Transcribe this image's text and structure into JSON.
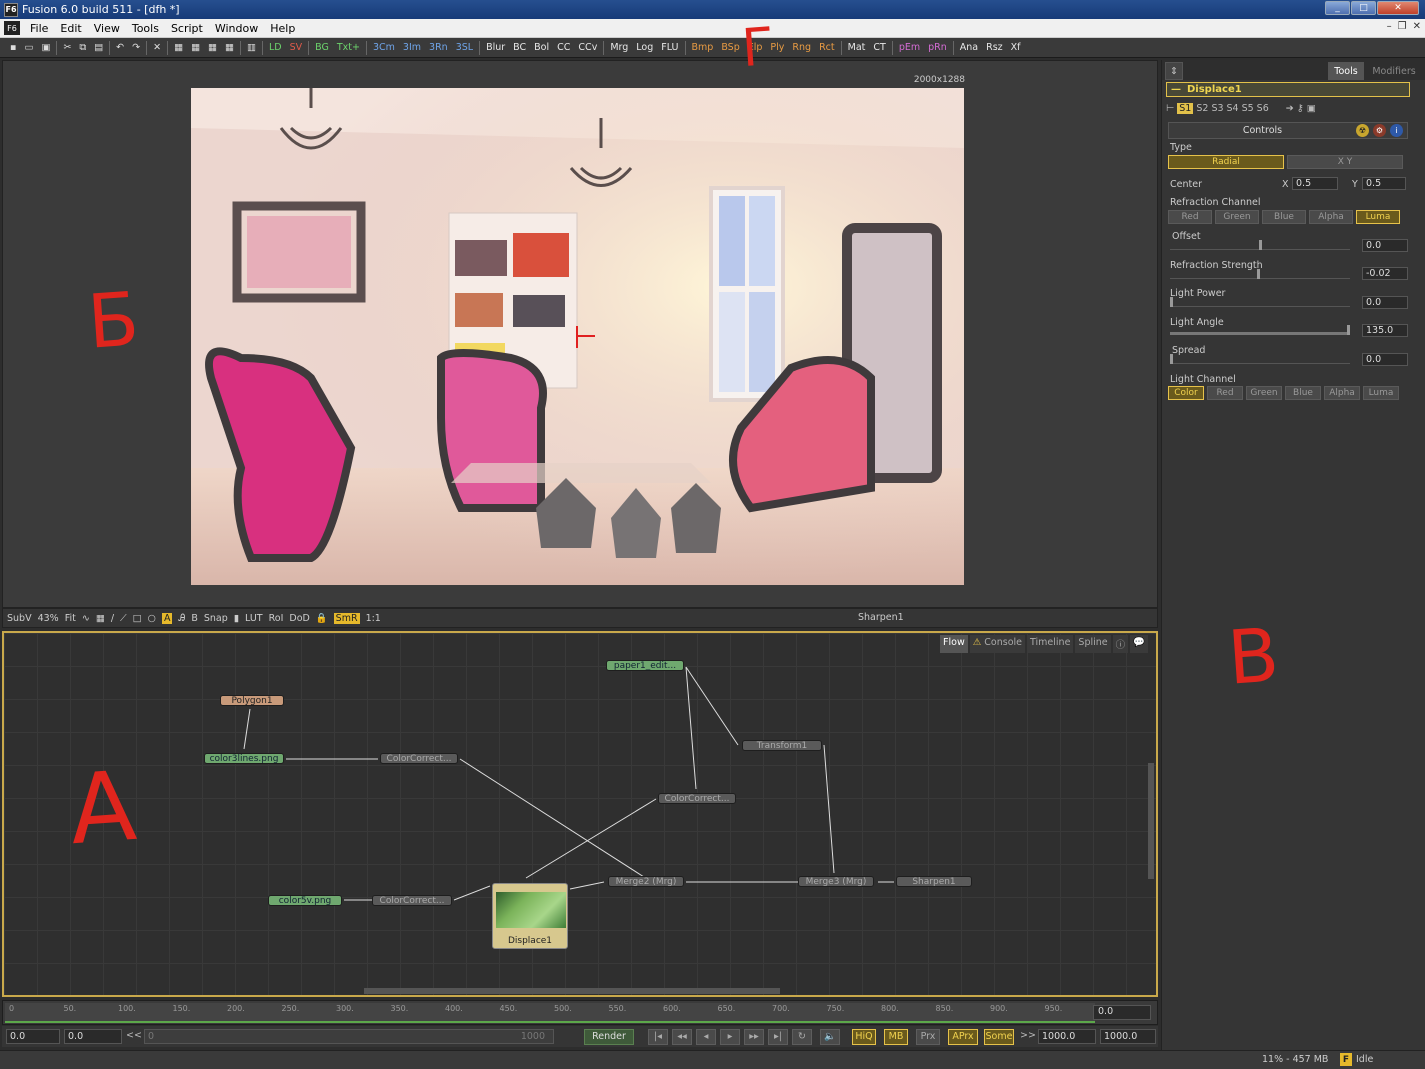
{
  "window": {
    "title": "Fusion 6.0 build 511 - [dfh *]",
    "app_icon": "F6",
    "controls": [
      "_",
      "□",
      "✕"
    ]
  },
  "menu": {
    "icon": "F6",
    "items": [
      "File",
      "Edit",
      "View",
      "Tools",
      "Script",
      "Window",
      "Help"
    ]
  },
  "toolbar": {
    "tools": [
      {
        "label": "LD",
        "color": "green"
      },
      {
        "label": "SV",
        "color": "red"
      },
      {
        "label": "BG",
        "color": "green"
      },
      {
        "label": "Txt+",
        "color": "green"
      },
      {
        "label": "3Cm",
        "color": "blue"
      },
      {
        "label": "3Im",
        "color": "blue"
      },
      {
        "label": "3Rn",
        "color": "blue"
      },
      {
        "label": "3SL",
        "color": "blue"
      },
      {
        "label": "Blur",
        "color": "white"
      },
      {
        "label": "BC",
        "color": "white"
      },
      {
        "label": "Bol",
        "color": "white"
      },
      {
        "label": "CC",
        "color": "white"
      },
      {
        "label": "CCv",
        "color": "white"
      },
      {
        "label": "Mrg",
        "color": "white"
      },
      {
        "label": "Log",
        "color": "white"
      },
      {
        "label": "FLU",
        "color": "white"
      },
      {
        "label": "Bmp",
        "color": "orange"
      },
      {
        "label": "BSp",
        "color": "orange"
      },
      {
        "label": "Elp",
        "color": "orange"
      },
      {
        "label": "Ply",
        "color": "orange"
      },
      {
        "label": "Rng",
        "color": "orange"
      },
      {
        "label": "Rct",
        "color": "orange"
      },
      {
        "label": "Mat",
        "color": "white"
      },
      {
        "label": "CT",
        "color": "white"
      },
      {
        "label": "pEm",
        "color": "magenta"
      },
      {
        "label": "pRn",
        "color": "magenta"
      },
      {
        "label": "Ana",
        "color": "white"
      },
      {
        "label": "Rsz",
        "color": "white"
      },
      {
        "label": "Xf",
        "color": "white"
      }
    ]
  },
  "viewer": {
    "resolution": "2000x1288",
    "name": "Sharpen1",
    "controls": [
      "SubV",
      "43%",
      "Fit",
      "Snap",
      "LUT",
      "RoI",
      "DoD",
      "SmR",
      "1:1"
    ],
    "buttons": [
      "A",
      "B"
    ]
  },
  "panel": {
    "tabs": [
      "Tools",
      "Modifiers"
    ],
    "tool_name": "Displace1",
    "subtabs": [
      "S1",
      "S2",
      "S3",
      "S4",
      "S5",
      "S6"
    ],
    "controls_label": "Controls",
    "type": {
      "label": "Type",
      "options": [
        "Radial",
        "X Y"
      ],
      "selected": "Radial"
    },
    "center": {
      "label": "Center",
      "x_label": "X",
      "x": "0.5",
      "y_label": "Y",
      "y": "0.5"
    },
    "refraction_channel": {
      "label": "Refraction Channel",
      "options": [
        "Red",
        "Green",
        "Blue",
        "Alpha",
        "Luma"
      ],
      "selected": "Luma"
    },
    "offset": {
      "label": "Offset",
      "value": "0.0",
      "level": 0.5
    },
    "refraction_strength": {
      "label": "Refraction Strength",
      "value": "-0.02",
      "level": 0.49
    },
    "light_power": {
      "label": "Light Power",
      "value": "0.0",
      "level": 0.0
    },
    "light_angle": {
      "label": "Light Angle",
      "value": "135.0",
      "level": 1.0
    },
    "spread": {
      "label": "Spread",
      "value": "0.0",
      "level": 0.0
    },
    "light_channel": {
      "label": "Light Channel",
      "options": [
        "Color",
        "Red",
        "Green",
        "Blue",
        "Alpha",
        "Luma"
      ],
      "selected": "Color"
    }
  },
  "flow": {
    "tabs": [
      "Flow",
      "Console",
      "Timeline",
      "Spline"
    ],
    "nodes": {
      "polygon": "Polygon1",
      "color3lines": "color3lines.png",
      "cc1": "ColorCorrect...",
      "paper": "paper1_edit...",
      "transform": "Transform1",
      "cc2": "ColorCorrect...",
      "color5v": "color5v.png",
      "cc3": "ColorCorrect...",
      "displace": "Displace1",
      "merge2": "Merge2  (Mrg)",
      "merge3": "Merge3  (Mrg)",
      "sharpen": "Sharpen1"
    }
  },
  "timeline": {
    "ticks": [
      "0",
      "50.",
      "100.",
      "150.",
      "200.",
      "250.",
      "300.",
      "350.",
      "400.",
      "450.",
      "500.",
      "550.",
      "600.",
      "650.",
      "700.",
      "750.",
      "800.",
      "850.",
      "900.",
      "950."
    ],
    "current": "0.0"
  },
  "transport": {
    "start": "0.0",
    "render_start": "0.0",
    "scroll_left": "<<",
    "scroll_start": "0",
    "scroll_end": "1000",
    "render": "Render",
    "hiq": "HiQ",
    "mb": "MB",
    "prx": "Prx",
    "aprx": "APrx",
    "some": "Some",
    "fwd": ">>",
    "render_end": "1000.0",
    "end": "1000.0"
  },
  "status": {
    "memory": "11% - 457 MB",
    "state": "Idle"
  },
  "annotations": {
    "a": "A",
    "b": "Б",
    "v": "В",
    "g": "Г"
  },
  "colors": {
    "accent": "#e6c24a",
    "node_green": "#6fa86f",
    "annotation": "#e0251d"
  }
}
